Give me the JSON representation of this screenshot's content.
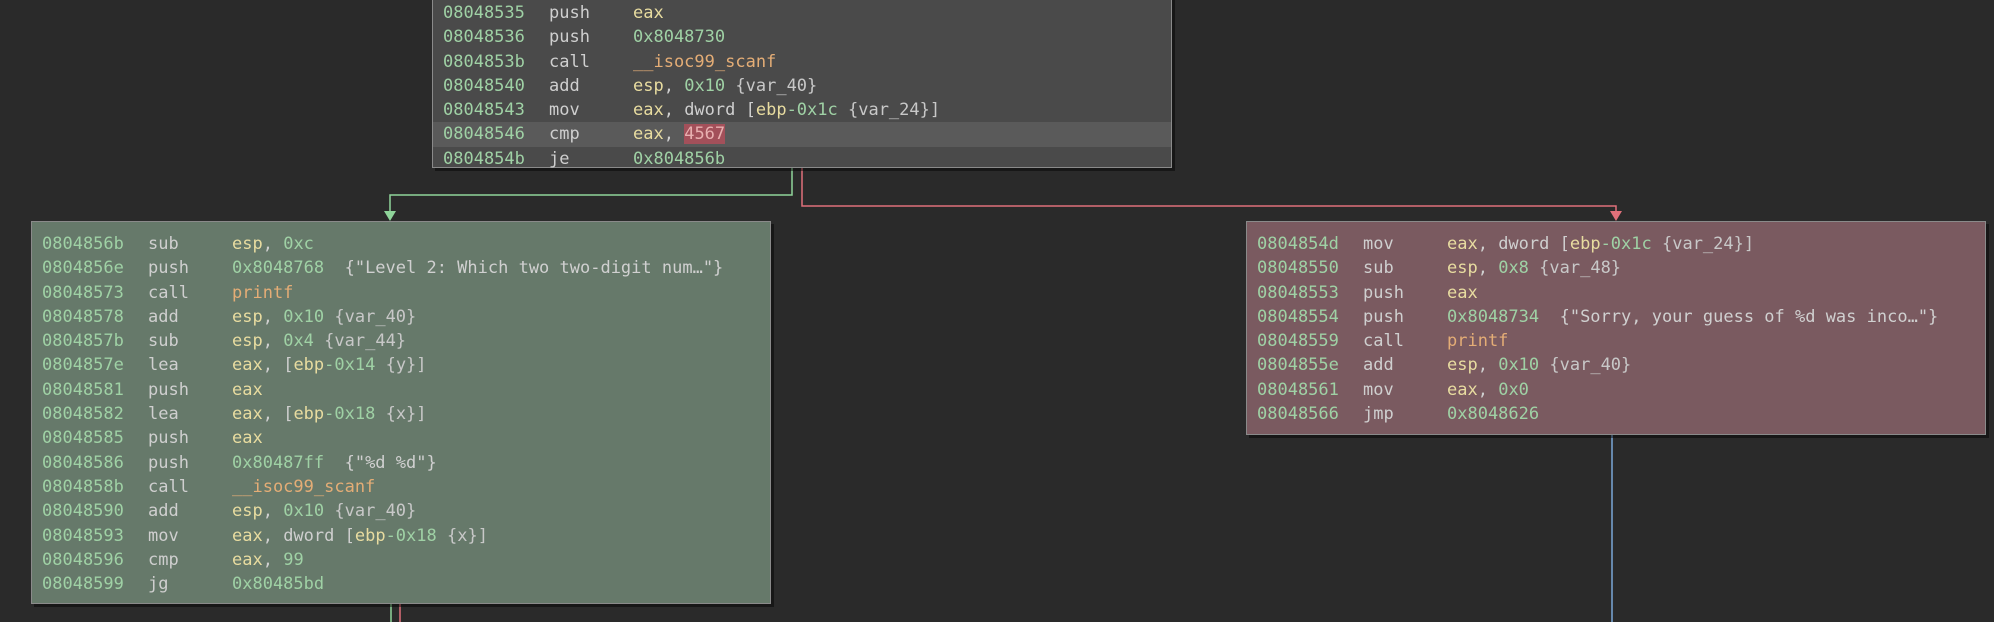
{
  "colors": {
    "background": "#2a2a2a",
    "block_top": "#4a4a4a",
    "block_true": "#66796a",
    "block_false": "#7a5a60",
    "edge_true": "#8fd49a",
    "edge_false": "#e0707a",
    "edge_unconditional": "#7aa8d8"
  },
  "blocks": {
    "top": {
      "lines": [
        {
          "addr": "08048535",
          "mnem": "push",
          "ops": [
            {
              "t": "eax",
              "k": "reg"
            }
          ]
        },
        {
          "addr": "08048536",
          "mnem": "push",
          "ops": [
            {
              "t": "0x8048730",
              "k": "num"
            }
          ]
        },
        {
          "addr": "0804853b",
          "mnem": "call",
          "ops": [
            {
              "t": "__isoc99_scanf",
              "k": "func"
            }
          ]
        },
        {
          "addr": "08048540",
          "mnem": "add",
          "ops": [
            {
              "t": "esp",
              "k": "reg"
            },
            {
              "t": ", ",
              "k": "txt"
            },
            {
              "t": "0x10",
              "k": "num"
            },
            {
              "t": " {var_40}",
              "k": "var"
            }
          ]
        },
        {
          "addr": "08048543",
          "mnem": "mov",
          "ops": [
            {
              "t": "eax",
              "k": "reg"
            },
            {
              "t": ", dword [",
              "k": "txt"
            },
            {
              "t": "ebp",
              "k": "reg"
            },
            {
              "t": "-0x1c",
              "k": "num"
            },
            {
              "t": " {var_24}]",
              "k": "var"
            }
          ]
        },
        {
          "addr": "08048546",
          "mnem": "cmp",
          "highlight": true,
          "ops": [
            {
              "t": "eax",
              "k": "reg"
            },
            {
              "t": ", ",
              "k": "txt"
            },
            {
              "t": "4567",
              "k": "hl"
            }
          ]
        },
        {
          "addr": "0804854b",
          "mnem": "je",
          "ops": [
            {
              "t": "0x804856b",
              "k": "num"
            }
          ]
        }
      ]
    },
    "left": {
      "lines": [
        {
          "addr": "0804856b",
          "mnem": "sub",
          "ops": [
            {
              "t": "esp",
              "k": "reg"
            },
            {
              "t": ", ",
              "k": "txt"
            },
            {
              "t": "0xc",
              "k": "num"
            }
          ]
        },
        {
          "addr": "0804856e",
          "mnem": "push",
          "ops": [
            {
              "t": "0x8048768",
              "k": "num"
            },
            {
              "t": "  {\"Level 2: Which two two-digit num…\"}",
              "k": "str"
            }
          ]
        },
        {
          "addr": "08048573",
          "mnem": "call",
          "ops": [
            {
              "t": "printf",
              "k": "func"
            }
          ]
        },
        {
          "addr": "08048578",
          "mnem": "add",
          "ops": [
            {
              "t": "esp",
              "k": "reg"
            },
            {
              "t": ", ",
              "k": "txt"
            },
            {
              "t": "0x10",
              "k": "num"
            },
            {
              "t": " {var_40}",
              "k": "var"
            }
          ]
        },
        {
          "addr": "0804857b",
          "mnem": "sub",
          "ops": [
            {
              "t": "esp",
              "k": "reg"
            },
            {
              "t": ", ",
              "k": "txt"
            },
            {
              "t": "0x4",
              "k": "num"
            },
            {
              "t": " {var_44}",
              "k": "var"
            }
          ]
        },
        {
          "addr": "0804857e",
          "mnem": "lea",
          "ops": [
            {
              "t": "eax",
              "k": "reg"
            },
            {
              "t": ", [",
              "k": "txt"
            },
            {
              "t": "ebp",
              "k": "reg"
            },
            {
              "t": "-0x14",
              "k": "num"
            },
            {
              "t": " {y}]",
              "k": "var"
            }
          ]
        },
        {
          "addr": "08048581",
          "mnem": "push",
          "ops": [
            {
              "t": "eax",
              "k": "reg"
            }
          ]
        },
        {
          "addr": "08048582",
          "mnem": "lea",
          "ops": [
            {
              "t": "eax",
              "k": "reg"
            },
            {
              "t": ", [",
              "k": "txt"
            },
            {
              "t": "ebp",
              "k": "reg"
            },
            {
              "t": "-0x18",
              "k": "num"
            },
            {
              "t": " {x}]",
              "k": "var"
            }
          ]
        },
        {
          "addr": "08048585",
          "mnem": "push",
          "ops": [
            {
              "t": "eax",
              "k": "reg"
            }
          ]
        },
        {
          "addr": "08048586",
          "mnem": "push",
          "ops": [
            {
              "t": "0x80487ff",
              "k": "num"
            },
            {
              "t": "  {\"%d %d\"}",
              "k": "str"
            }
          ]
        },
        {
          "addr": "0804858b",
          "mnem": "call",
          "ops": [
            {
              "t": "__isoc99_scanf",
              "k": "func"
            }
          ]
        },
        {
          "addr": "08048590",
          "mnem": "add",
          "ops": [
            {
              "t": "esp",
              "k": "reg"
            },
            {
              "t": ", ",
              "k": "txt"
            },
            {
              "t": "0x10",
              "k": "num"
            },
            {
              "t": " {var_40}",
              "k": "var"
            }
          ]
        },
        {
          "addr": "08048593",
          "mnem": "mov",
          "ops": [
            {
              "t": "eax",
              "k": "reg"
            },
            {
              "t": ", dword [",
              "k": "txt"
            },
            {
              "t": "ebp",
              "k": "reg"
            },
            {
              "t": "-0x18",
              "k": "num"
            },
            {
              "t": " {x}]",
              "k": "var"
            }
          ]
        },
        {
          "addr": "08048596",
          "mnem": "cmp",
          "ops": [
            {
              "t": "eax",
              "k": "reg"
            },
            {
              "t": ", ",
              "k": "txt"
            },
            {
              "t": "99",
              "k": "num"
            }
          ]
        },
        {
          "addr": "08048599",
          "mnem": "jg",
          "ops": [
            {
              "t": "0x80485bd",
              "k": "num"
            }
          ]
        }
      ]
    },
    "right": {
      "lines": [
        {
          "addr": "0804854d",
          "mnem": "mov",
          "ops": [
            {
              "t": "eax",
              "k": "reg"
            },
            {
              "t": ", dword [",
              "k": "txt"
            },
            {
              "t": "ebp",
              "k": "reg"
            },
            {
              "t": "-0x1c",
              "k": "num"
            },
            {
              "t": " {var_24}]",
              "k": "var"
            }
          ]
        },
        {
          "addr": "08048550",
          "mnem": "sub",
          "ops": [
            {
              "t": "esp",
              "k": "reg"
            },
            {
              "t": ", ",
              "k": "txt"
            },
            {
              "t": "0x8",
              "k": "num"
            },
            {
              "t": " {var_48}",
              "k": "var"
            }
          ]
        },
        {
          "addr": "08048553",
          "mnem": "push",
          "ops": [
            {
              "t": "eax",
              "k": "reg"
            }
          ]
        },
        {
          "addr": "08048554",
          "mnem": "push",
          "ops": [
            {
              "t": "0x8048734",
              "k": "num"
            },
            {
              "t": "  {\"Sorry, your guess of %d was inco…\"}",
              "k": "str"
            }
          ]
        },
        {
          "addr": "08048559",
          "mnem": "call",
          "ops": [
            {
              "t": "printf",
              "k": "func"
            }
          ]
        },
        {
          "addr": "0804855e",
          "mnem": "add",
          "ops": [
            {
              "t": "esp",
              "k": "reg"
            },
            {
              "t": ", ",
              "k": "txt"
            },
            {
              "t": "0x10",
              "k": "num"
            },
            {
              "t": " {var_40}",
              "k": "var"
            }
          ]
        },
        {
          "addr": "08048561",
          "mnem": "mov",
          "ops": [
            {
              "t": "eax",
              "k": "reg"
            },
            {
              "t": ", ",
              "k": "txt"
            },
            {
              "t": "0x0",
              "k": "num"
            }
          ]
        },
        {
          "addr": "08048566",
          "mnem": "jmp",
          "ops": [
            {
              "t": "0x8048626",
              "k": "num"
            }
          ]
        }
      ]
    }
  }
}
